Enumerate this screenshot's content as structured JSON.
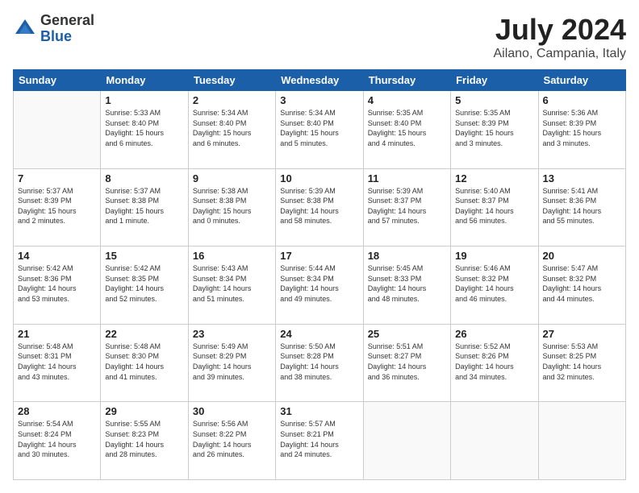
{
  "logo": {
    "general": "General",
    "blue": "Blue"
  },
  "header": {
    "month_year": "July 2024",
    "location": "Ailano, Campania, Italy"
  },
  "weekdays": [
    "Sunday",
    "Monday",
    "Tuesday",
    "Wednesday",
    "Thursday",
    "Friday",
    "Saturday"
  ],
  "weeks": [
    [
      {
        "day": "",
        "info": ""
      },
      {
        "day": "1",
        "info": "Sunrise: 5:33 AM\nSunset: 8:40 PM\nDaylight: 15 hours\nand 6 minutes."
      },
      {
        "day": "2",
        "info": "Sunrise: 5:34 AM\nSunset: 8:40 PM\nDaylight: 15 hours\nand 6 minutes."
      },
      {
        "day": "3",
        "info": "Sunrise: 5:34 AM\nSunset: 8:40 PM\nDaylight: 15 hours\nand 5 minutes."
      },
      {
        "day": "4",
        "info": "Sunrise: 5:35 AM\nSunset: 8:40 PM\nDaylight: 15 hours\nand 4 minutes."
      },
      {
        "day": "5",
        "info": "Sunrise: 5:35 AM\nSunset: 8:39 PM\nDaylight: 15 hours\nand 3 minutes."
      },
      {
        "day": "6",
        "info": "Sunrise: 5:36 AM\nSunset: 8:39 PM\nDaylight: 15 hours\nand 3 minutes."
      }
    ],
    [
      {
        "day": "7",
        "info": "Sunrise: 5:37 AM\nSunset: 8:39 PM\nDaylight: 15 hours\nand 2 minutes."
      },
      {
        "day": "8",
        "info": "Sunrise: 5:37 AM\nSunset: 8:38 PM\nDaylight: 15 hours\nand 1 minute."
      },
      {
        "day": "9",
        "info": "Sunrise: 5:38 AM\nSunset: 8:38 PM\nDaylight: 15 hours\nand 0 minutes."
      },
      {
        "day": "10",
        "info": "Sunrise: 5:39 AM\nSunset: 8:38 PM\nDaylight: 14 hours\nand 58 minutes."
      },
      {
        "day": "11",
        "info": "Sunrise: 5:39 AM\nSunset: 8:37 PM\nDaylight: 14 hours\nand 57 minutes."
      },
      {
        "day": "12",
        "info": "Sunrise: 5:40 AM\nSunset: 8:37 PM\nDaylight: 14 hours\nand 56 minutes."
      },
      {
        "day": "13",
        "info": "Sunrise: 5:41 AM\nSunset: 8:36 PM\nDaylight: 14 hours\nand 55 minutes."
      }
    ],
    [
      {
        "day": "14",
        "info": "Sunrise: 5:42 AM\nSunset: 8:36 PM\nDaylight: 14 hours\nand 53 minutes."
      },
      {
        "day": "15",
        "info": "Sunrise: 5:42 AM\nSunset: 8:35 PM\nDaylight: 14 hours\nand 52 minutes."
      },
      {
        "day": "16",
        "info": "Sunrise: 5:43 AM\nSunset: 8:34 PM\nDaylight: 14 hours\nand 51 minutes."
      },
      {
        "day": "17",
        "info": "Sunrise: 5:44 AM\nSunset: 8:34 PM\nDaylight: 14 hours\nand 49 minutes."
      },
      {
        "day": "18",
        "info": "Sunrise: 5:45 AM\nSunset: 8:33 PM\nDaylight: 14 hours\nand 48 minutes."
      },
      {
        "day": "19",
        "info": "Sunrise: 5:46 AM\nSunset: 8:32 PM\nDaylight: 14 hours\nand 46 minutes."
      },
      {
        "day": "20",
        "info": "Sunrise: 5:47 AM\nSunset: 8:32 PM\nDaylight: 14 hours\nand 44 minutes."
      }
    ],
    [
      {
        "day": "21",
        "info": "Sunrise: 5:48 AM\nSunset: 8:31 PM\nDaylight: 14 hours\nand 43 minutes."
      },
      {
        "day": "22",
        "info": "Sunrise: 5:48 AM\nSunset: 8:30 PM\nDaylight: 14 hours\nand 41 minutes."
      },
      {
        "day": "23",
        "info": "Sunrise: 5:49 AM\nSunset: 8:29 PM\nDaylight: 14 hours\nand 39 minutes."
      },
      {
        "day": "24",
        "info": "Sunrise: 5:50 AM\nSunset: 8:28 PM\nDaylight: 14 hours\nand 38 minutes."
      },
      {
        "day": "25",
        "info": "Sunrise: 5:51 AM\nSunset: 8:27 PM\nDaylight: 14 hours\nand 36 minutes."
      },
      {
        "day": "26",
        "info": "Sunrise: 5:52 AM\nSunset: 8:26 PM\nDaylight: 14 hours\nand 34 minutes."
      },
      {
        "day": "27",
        "info": "Sunrise: 5:53 AM\nSunset: 8:25 PM\nDaylight: 14 hours\nand 32 minutes."
      }
    ],
    [
      {
        "day": "28",
        "info": "Sunrise: 5:54 AM\nSunset: 8:24 PM\nDaylight: 14 hours\nand 30 minutes."
      },
      {
        "day": "29",
        "info": "Sunrise: 5:55 AM\nSunset: 8:23 PM\nDaylight: 14 hours\nand 28 minutes."
      },
      {
        "day": "30",
        "info": "Sunrise: 5:56 AM\nSunset: 8:22 PM\nDaylight: 14 hours\nand 26 minutes."
      },
      {
        "day": "31",
        "info": "Sunrise: 5:57 AM\nSunset: 8:21 PM\nDaylight: 14 hours\nand 24 minutes."
      },
      {
        "day": "",
        "info": ""
      },
      {
        "day": "",
        "info": ""
      },
      {
        "day": "",
        "info": ""
      }
    ]
  ]
}
